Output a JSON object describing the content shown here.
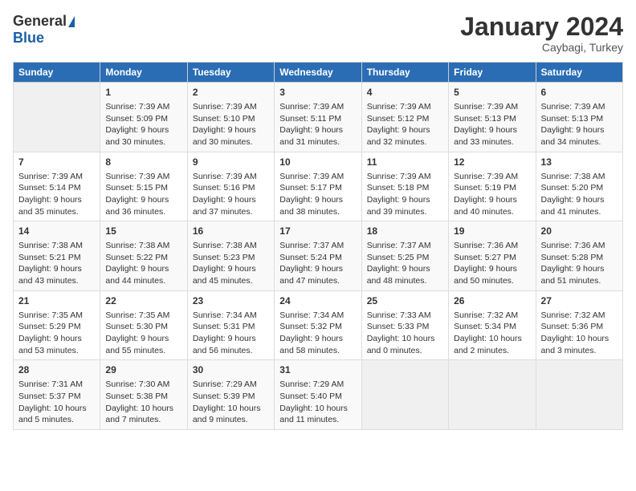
{
  "logo": {
    "general": "General",
    "blue": "Blue"
  },
  "title": "January 2024",
  "subtitle": "Caybagi, Turkey",
  "days_of_week": [
    "Sunday",
    "Monday",
    "Tuesday",
    "Wednesday",
    "Thursday",
    "Friday",
    "Saturday"
  ],
  "weeks": [
    [
      {
        "day": "",
        "info": ""
      },
      {
        "day": "1",
        "info": "Sunrise: 7:39 AM\nSunset: 5:09 PM\nDaylight: 9 hours\nand 30 minutes."
      },
      {
        "day": "2",
        "info": "Sunrise: 7:39 AM\nSunset: 5:10 PM\nDaylight: 9 hours\nand 30 minutes."
      },
      {
        "day": "3",
        "info": "Sunrise: 7:39 AM\nSunset: 5:11 PM\nDaylight: 9 hours\nand 31 minutes."
      },
      {
        "day": "4",
        "info": "Sunrise: 7:39 AM\nSunset: 5:12 PM\nDaylight: 9 hours\nand 32 minutes."
      },
      {
        "day": "5",
        "info": "Sunrise: 7:39 AM\nSunset: 5:13 PM\nDaylight: 9 hours\nand 33 minutes."
      },
      {
        "day": "6",
        "info": "Sunrise: 7:39 AM\nSunset: 5:13 PM\nDaylight: 9 hours\nand 34 minutes."
      }
    ],
    [
      {
        "day": "7",
        "info": "Sunrise: 7:39 AM\nSunset: 5:14 PM\nDaylight: 9 hours\nand 35 minutes."
      },
      {
        "day": "8",
        "info": "Sunrise: 7:39 AM\nSunset: 5:15 PM\nDaylight: 9 hours\nand 36 minutes."
      },
      {
        "day": "9",
        "info": "Sunrise: 7:39 AM\nSunset: 5:16 PM\nDaylight: 9 hours\nand 37 minutes."
      },
      {
        "day": "10",
        "info": "Sunrise: 7:39 AM\nSunset: 5:17 PM\nDaylight: 9 hours\nand 38 minutes."
      },
      {
        "day": "11",
        "info": "Sunrise: 7:39 AM\nSunset: 5:18 PM\nDaylight: 9 hours\nand 39 minutes."
      },
      {
        "day": "12",
        "info": "Sunrise: 7:39 AM\nSunset: 5:19 PM\nDaylight: 9 hours\nand 40 minutes."
      },
      {
        "day": "13",
        "info": "Sunrise: 7:38 AM\nSunset: 5:20 PM\nDaylight: 9 hours\nand 41 minutes."
      }
    ],
    [
      {
        "day": "14",
        "info": "Sunrise: 7:38 AM\nSunset: 5:21 PM\nDaylight: 9 hours\nand 43 minutes."
      },
      {
        "day": "15",
        "info": "Sunrise: 7:38 AM\nSunset: 5:22 PM\nDaylight: 9 hours\nand 44 minutes."
      },
      {
        "day": "16",
        "info": "Sunrise: 7:38 AM\nSunset: 5:23 PM\nDaylight: 9 hours\nand 45 minutes."
      },
      {
        "day": "17",
        "info": "Sunrise: 7:37 AM\nSunset: 5:24 PM\nDaylight: 9 hours\nand 47 minutes."
      },
      {
        "day": "18",
        "info": "Sunrise: 7:37 AM\nSunset: 5:25 PM\nDaylight: 9 hours\nand 48 minutes."
      },
      {
        "day": "19",
        "info": "Sunrise: 7:36 AM\nSunset: 5:27 PM\nDaylight: 9 hours\nand 50 minutes."
      },
      {
        "day": "20",
        "info": "Sunrise: 7:36 AM\nSunset: 5:28 PM\nDaylight: 9 hours\nand 51 minutes."
      }
    ],
    [
      {
        "day": "21",
        "info": "Sunrise: 7:35 AM\nSunset: 5:29 PM\nDaylight: 9 hours\nand 53 minutes."
      },
      {
        "day": "22",
        "info": "Sunrise: 7:35 AM\nSunset: 5:30 PM\nDaylight: 9 hours\nand 55 minutes."
      },
      {
        "day": "23",
        "info": "Sunrise: 7:34 AM\nSunset: 5:31 PM\nDaylight: 9 hours\nand 56 minutes."
      },
      {
        "day": "24",
        "info": "Sunrise: 7:34 AM\nSunset: 5:32 PM\nDaylight: 9 hours\nand 58 minutes."
      },
      {
        "day": "25",
        "info": "Sunrise: 7:33 AM\nSunset: 5:33 PM\nDaylight: 10 hours\nand 0 minutes."
      },
      {
        "day": "26",
        "info": "Sunrise: 7:32 AM\nSunset: 5:34 PM\nDaylight: 10 hours\nand 2 minutes."
      },
      {
        "day": "27",
        "info": "Sunrise: 7:32 AM\nSunset: 5:36 PM\nDaylight: 10 hours\nand 3 minutes."
      }
    ],
    [
      {
        "day": "28",
        "info": "Sunrise: 7:31 AM\nSunset: 5:37 PM\nDaylight: 10 hours\nand 5 minutes."
      },
      {
        "day": "29",
        "info": "Sunrise: 7:30 AM\nSunset: 5:38 PM\nDaylight: 10 hours\nand 7 minutes."
      },
      {
        "day": "30",
        "info": "Sunrise: 7:29 AM\nSunset: 5:39 PM\nDaylight: 10 hours\nand 9 minutes."
      },
      {
        "day": "31",
        "info": "Sunrise: 7:29 AM\nSunset: 5:40 PM\nDaylight: 10 hours\nand 11 minutes."
      },
      {
        "day": "",
        "info": ""
      },
      {
        "day": "",
        "info": ""
      },
      {
        "day": "",
        "info": ""
      }
    ]
  ]
}
